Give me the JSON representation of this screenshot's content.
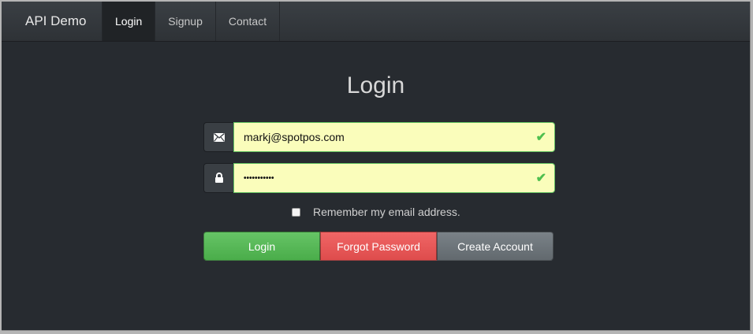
{
  "navbar": {
    "brand": "API Demo",
    "items": [
      {
        "label": "Login",
        "active": true
      },
      {
        "label": "Signup",
        "active": false
      },
      {
        "label": "Contact",
        "active": false
      }
    ]
  },
  "form": {
    "title": "Login",
    "email": {
      "value": "markj@spotpos.com",
      "icon": "envelope-icon",
      "valid": true
    },
    "password": {
      "value": "•••••••••••",
      "icon": "lock-icon",
      "valid": true
    },
    "remember_label": "Remember my email address.",
    "remember_checked": false,
    "buttons": {
      "login": "Login",
      "forgot": "Forgot Password",
      "create": "Create Account"
    }
  },
  "colors": {
    "background": "#272b30",
    "navbar": "#3a3f44",
    "valid_field": "#fafdbb",
    "success": "#5cb85c",
    "danger": "#ee5f5b",
    "default": "#7a8288"
  }
}
